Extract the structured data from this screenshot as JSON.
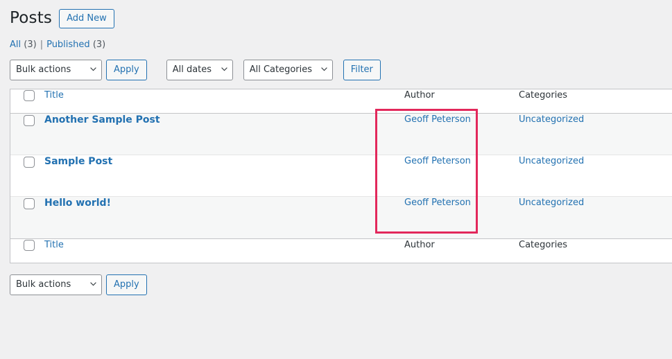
{
  "header": {
    "title": "Posts",
    "add_new_label": "Add New"
  },
  "status_links": {
    "all_label": "All",
    "all_count": "(3)",
    "separator": "|",
    "published_label": "Published",
    "published_count": "(3)"
  },
  "tablenav_top": {
    "bulk_actions_value": "Bulk actions",
    "apply_label": "Apply",
    "dates_value": "All dates",
    "categories_value": "All Categories",
    "filter_label": "Filter"
  },
  "tablenav_bottom": {
    "bulk_actions_value": "Bulk actions",
    "apply_label": "Apply"
  },
  "table": {
    "columns": {
      "title": "Title",
      "author": "Author",
      "categories": "Categories"
    },
    "rows": [
      {
        "title": "Another Sample Post",
        "author": "Geoff Peterson",
        "categories": "Uncategorized"
      },
      {
        "title": "Sample Post",
        "author": "Geoff Peterson",
        "categories": "Uncategorized"
      },
      {
        "title": "Hello world!",
        "author": "Geoff Peterson",
        "categories": "Uncategorized"
      }
    ]
  },
  "annotation": {
    "highlight_color": "#e2285b"
  },
  "colors": {
    "link": "#2271b1",
    "page_background": "#f0f0f1",
    "row_alt_background": "#f6f7f7",
    "heading_text": "#1d2327"
  }
}
